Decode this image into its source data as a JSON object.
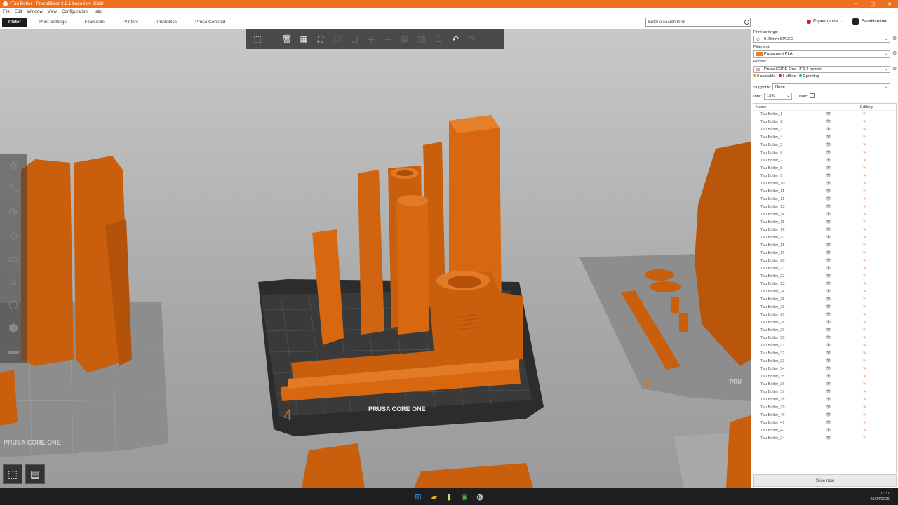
{
  "window": {
    "title": "*Tau Bolter - PrusaSlicer-2.9.1 based on Slic3r",
    "minimize": "─",
    "maximize": "☐",
    "close": "✕"
  },
  "menu": [
    "File",
    "Edit",
    "Window",
    "View",
    "Configuration",
    "Help"
  ],
  "tabs": [
    "Plater",
    "Print Settings",
    "Filaments",
    "Printers",
    "Printables",
    "Prusa Connect"
  ],
  "search": {
    "placeholder": "Enter a search term"
  },
  "mode": {
    "label": "Expert mode",
    "color": "#d01818"
  },
  "user": {
    "name": "FauxHammer"
  },
  "sidebar": {
    "print_settings_label": "Print settings:",
    "print_settings_value": "0.25mm SPEED",
    "filament_label": "Filament:",
    "filament_value": "Prusament PLA",
    "filament_color": "#e8831f",
    "printer_label": "Printer:",
    "printer_value": "Prusa CORE One HF0.4 nozzle",
    "status": {
      "available": "0 available",
      "offline": "1 offline",
      "printing": "0 printing"
    },
    "supports_label": "Supports:",
    "supports_value": "None",
    "infill_label": "Infill:",
    "infill_value": "15%",
    "brim_label": "Brim:",
    "col_name": "Name",
    "col_editing": "Editing",
    "objects": [
      "Tau Bolter_1",
      "Tau Bolter_2",
      "Tau Bolter_3",
      "Tau Bolter_4",
      "Tau Bolter_5",
      "Tau Bolter_6",
      "Tau Bolter_7",
      "Tau Bolter_8",
      "Tau Bolter_9",
      "Tau Bolter_10",
      "Tau Bolter_11",
      "Tau Bolter_12",
      "Tau Bolter_13",
      "Tau Bolter_14",
      "Tau Bolter_15",
      "Tau Bolter_16",
      "Tau Bolter_17",
      "Tau Bolter_18",
      "Tau Bolter_19",
      "Tau Bolter_20",
      "Tau Bolter_21",
      "Tau Bolter_22",
      "Tau Bolter_23",
      "Tau Bolter_24",
      "Tau Bolter_25",
      "Tau Bolter_26",
      "Tau Bolter_27",
      "Tau Bolter_28",
      "Tau Bolter_29",
      "Tau Bolter_30",
      "Tau Bolter_31",
      "Tau Bolter_32",
      "Tau Bolter_33",
      "Tau Bolter_34",
      "Tau Bolter_35",
      "Tau Bolter_36",
      "Tau Bolter_37",
      "Tau Bolter_38",
      "Tau Bolter_39",
      "Tau Bolter_40",
      "Tau Bolter_41",
      "Tau Bolter_42",
      "Tau Bolter_24"
    ],
    "slice_label": "Slice now"
  },
  "viewport": {
    "plate_center_logo": "PRUSA CORE ONE",
    "plate_left_logo": "PRUSA CORE ONE",
    "plate_right_logo": "PRU",
    "plate_center_number": "4",
    "plate_right_number": "6",
    "model_color": "#d8680f"
  },
  "clock": {
    "time": "11:37",
    "date": "05/04/2025"
  }
}
